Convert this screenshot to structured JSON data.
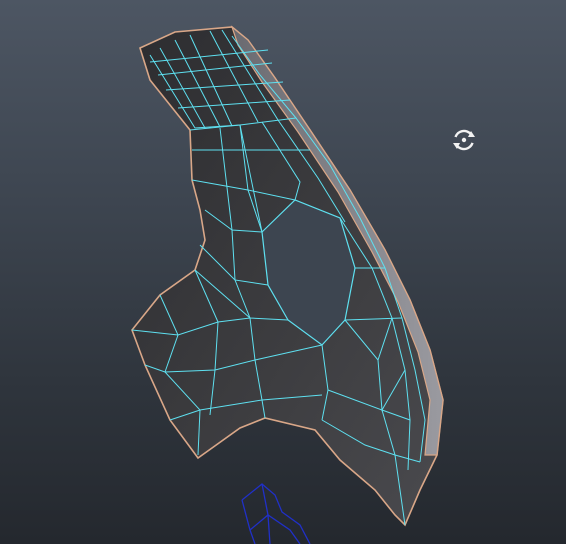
{
  "viewport": {
    "background_top": "#4d5663",
    "background_bottom": "#24282e"
  },
  "mesh": {
    "face_color": "#3a3a3c",
    "face_light": "#55555a",
    "border_color": "#d9a788",
    "wire_color": "#5ee0f0"
  },
  "secondary_object": {
    "wire_color": "#2030c8"
  },
  "tools": {
    "rotate_icon": "orbit-rotate-icon",
    "icon_color": "#f2f2f2"
  }
}
